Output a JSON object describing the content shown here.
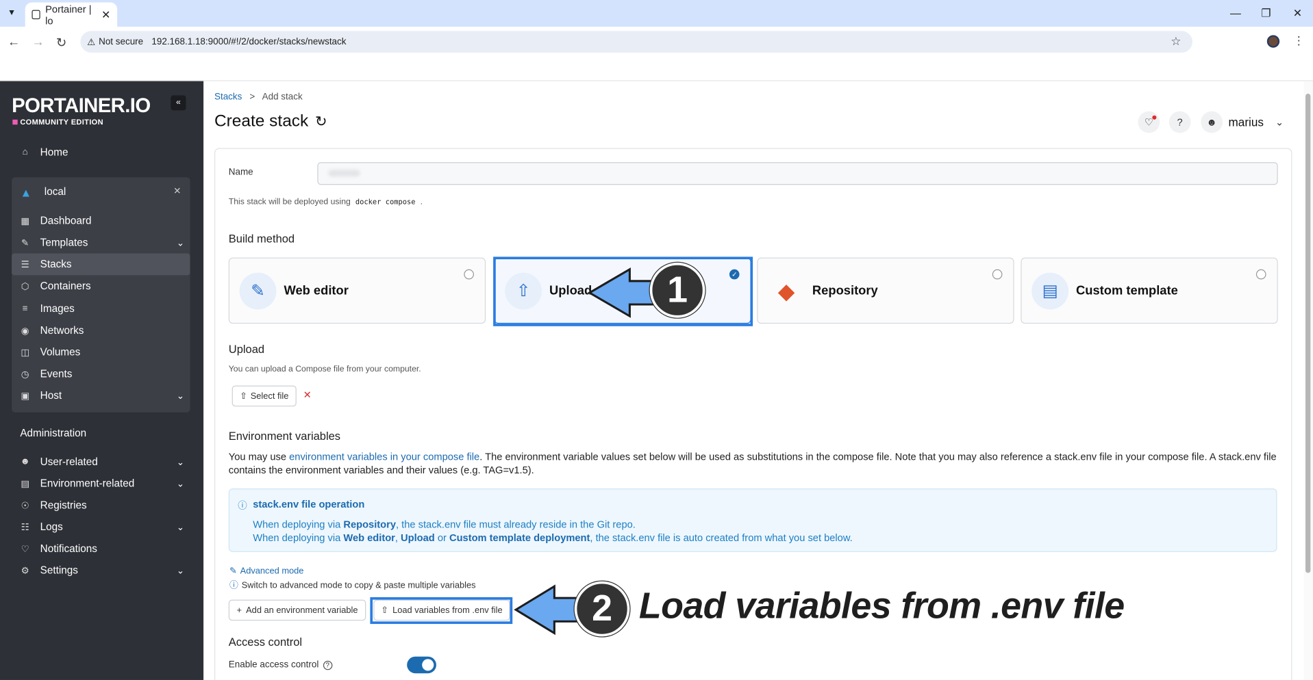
{
  "browser": {
    "tab_title": "Portainer | lo",
    "not_secure": "Not secure",
    "url": "192.168.1.18:9000/#!/2/docker/stacks/newstack"
  },
  "sidebar": {
    "logo": "PORTAINER.IO",
    "edition": "COMMUNITY EDITION",
    "home": "Home",
    "environment": "local",
    "env_items": [
      "Dashboard",
      "Templates",
      "Stacks",
      "Containers",
      "Images",
      "Networks",
      "Volumes",
      "Events",
      "Host"
    ],
    "admin_header": "Administration",
    "admin_items": [
      "User-related",
      "Environment-related",
      "Registries",
      "Logs",
      "Notifications",
      "Settings"
    ]
  },
  "header": {
    "crumb_root": "Stacks",
    "crumb_sep": ">",
    "crumb_current": "Add stack",
    "title": "Create stack",
    "user": "marius"
  },
  "form": {
    "name_label": "Name",
    "deploy_note_pre": "This stack will be deployed using",
    "deploy_note_code": "docker compose",
    "deploy_note_post": ".",
    "build_method_heading": "Build method",
    "methods": [
      "Web editor",
      "Upload",
      "Repository",
      "Custom template"
    ],
    "selected_method": "Upload",
    "upload_heading": "Upload",
    "upload_hint": "You can upload a Compose file from your computer.",
    "select_file": "Select file",
    "env_heading": "Environment variables",
    "env_desc_pre": "You may use ",
    "env_desc_link": "environment variables in your compose file",
    "env_desc_post": ". The environment variable values set below will be used as substitutions in the compose file. Note that you may also reference a stack.env file in your compose file. A stack.env file contains the environment variables and their values (e.g. TAG=v1.5).",
    "info_title": "stack.env file operation",
    "info_l1_pre": "When deploying via ",
    "info_l1_b": "Repository",
    "info_l1_post": ", the stack.env file must already reside in the Git repo.",
    "info_l2_pre": "When deploying via ",
    "info_l2_b1": "Web editor",
    "info_l2_c1": ", ",
    "info_l2_b2": "Upload",
    "info_l2_c2": " or ",
    "info_l2_b3": "Custom template deployment",
    "info_l2_post": ", the stack.env file is auto created from what you set below.",
    "advanced_mode": "Advanced mode",
    "advanced_hint": "Switch to advanced mode to copy & paste multiple variables",
    "add_env_var": "Add an environment variable",
    "load_env": "Load variables from .env file",
    "access_heading": "Access control",
    "enable_access": "Enable access control"
  },
  "annotations": {
    "step1": "1",
    "step2": "2",
    "step2_label": "Load variables from .env file"
  },
  "colors": {
    "accent": "#1c6bb0",
    "highlight": "#2a7de1",
    "arrow": "#6aa8f0",
    "sidebar": "#2d3036"
  }
}
